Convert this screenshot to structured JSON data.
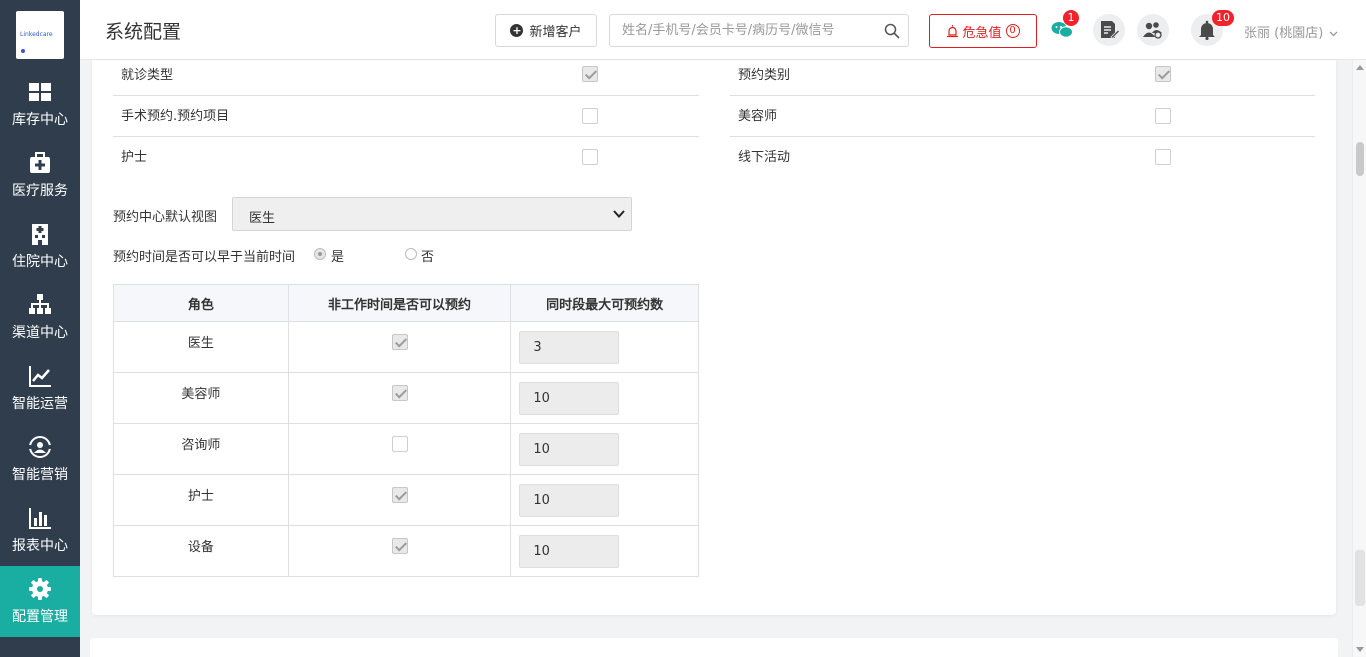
{
  "sidebar": {
    "logo_text": "Linkedcare",
    "items": [
      {
        "label": "库存中心",
        "icon": "grid-icon"
      },
      {
        "label": "医疗服务",
        "icon": "medical-kit-icon"
      },
      {
        "label": "住院中心",
        "icon": "hospital-building-icon"
      },
      {
        "label": "渠道中心",
        "icon": "org-chart-icon"
      },
      {
        "label": "智能运营",
        "icon": "trend-chart-icon"
      },
      {
        "label": "智能营销",
        "icon": "user-group-icon"
      },
      {
        "label": "报表中心",
        "icon": "bar-report-icon"
      },
      {
        "label": "配置管理",
        "icon": "gear-icon",
        "active": true
      }
    ],
    "active_color": "#1aaea3",
    "bg_color": "#2f3d4c"
  },
  "header": {
    "title": "系统配置",
    "add_customer_label": "新增客户",
    "search_placeholder": "姓名/手机号/会员卡号/病历号/微信号",
    "danger_label": "危急值",
    "danger_count": "0",
    "wechat_badge": "1",
    "bell_badge": "10",
    "user_label": "张丽 (桃園店)"
  },
  "booking_types": {
    "left": [
      {
        "label": "就诊类型",
        "checked": true
      },
      {
        "label": "手术预约.预约项目",
        "checked": false
      },
      {
        "label": "护士",
        "checked": false
      }
    ],
    "right": [
      {
        "label": "预约类别",
        "checked": true
      },
      {
        "label": "美容师",
        "checked": false
      },
      {
        "label": "线下活动",
        "checked": false
      }
    ]
  },
  "default_view": {
    "label": "预约中心默认视图",
    "value": "医生"
  },
  "early_booking": {
    "label": "预约时间是否可以早于当前时间",
    "yes_label": "是",
    "no_label": "否",
    "selected": "是"
  },
  "role_table": {
    "headers": [
      "角色",
      "非工作时间是否可以预约",
      "同时段最大可预约数"
    ],
    "rows": [
      {
        "role": "医生",
        "allow": true,
        "max": "3"
      },
      {
        "role": "美容师",
        "allow": true,
        "max": "10"
      },
      {
        "role": "咨询师",
        "allow": false,
        "max": "10"
      },
      {
        "role": "护士",
        "allow": true,
        "max": "10"
      },
      {
        "role": "设备",
        "allow": true,
        "max": "10"
      }
    ]
  }
}
